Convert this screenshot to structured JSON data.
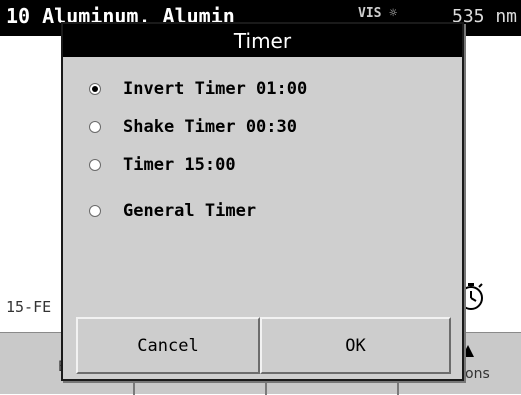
{
  "background": {
    "method_title": "10 Aluminum, Alumin",
    "status_text": "VIS ☼",
    "wavelength": "535 nm",
    "date_text": "15-FE",
    "bottom_left_label": "E",
    "bottom_right_label": "ons"
  },
  "dialog": {
    "title": "Timer",
    "options": [
      {
        "label": "Invert Timer 01:00",
        "selected": true
      },
      {
        "label": "Shake Timer 00:30",
        "selected": false
      },
      {
        "label": "Timer 15:00",
        "selected": false
      },
      {
        "label": "General Timer",
        "selected": false
      }
    ],
    "cancel_label": "Cancel",
    "ok_label": "OK"
  },
  "colors": {
    "title_bar": "#000000",
    "dialog_bg": "#cfcfcf",
    "bottom_bar": "#c9c9c9"
  },
  "icons": {
    "timer": "timer-icon",
    "options_arrow": "arrow-up-icon"
  }
}
